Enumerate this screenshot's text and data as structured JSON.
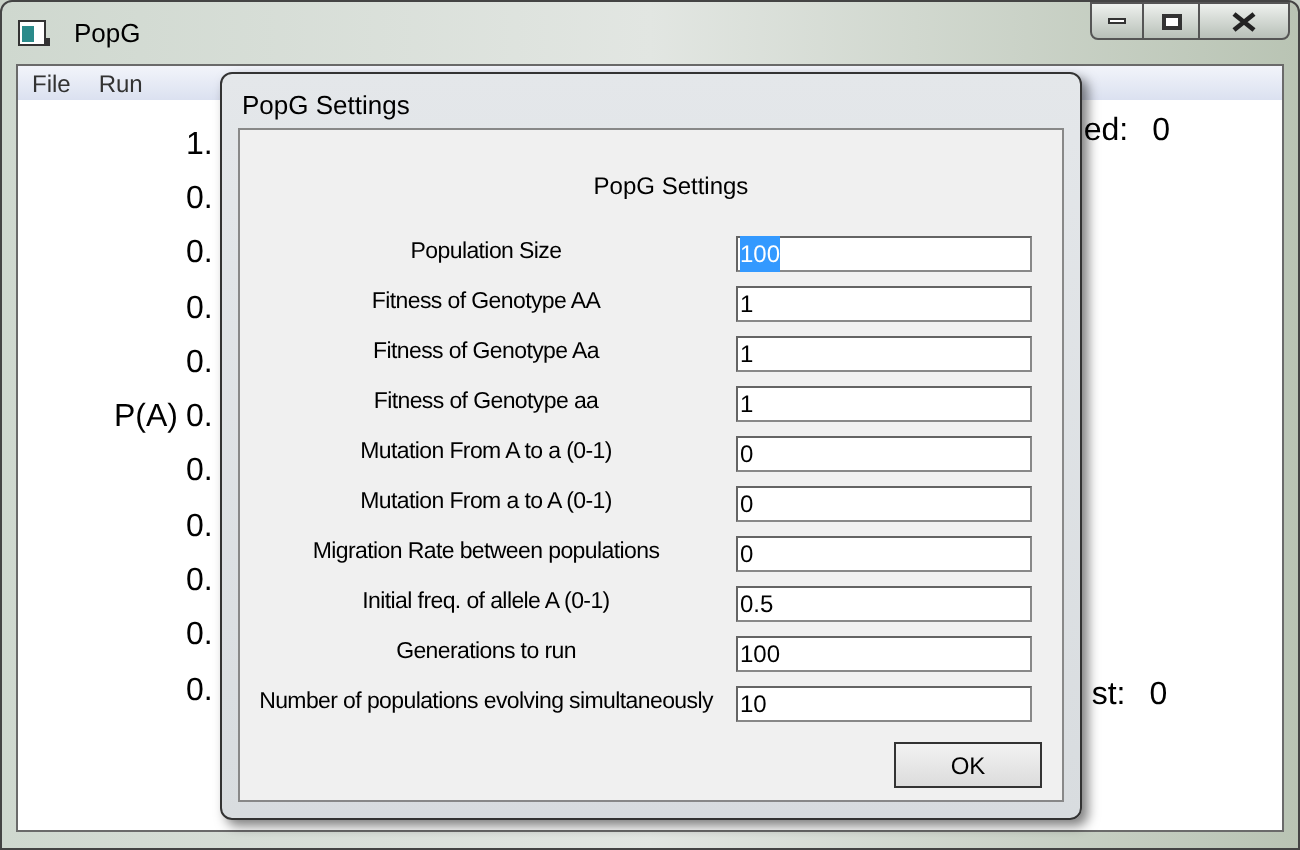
{
  "window": {
    "title": "PopG"
  },
  "menu": [
    "File",
    "Run"
  ],
  "plot": {
    "y_ticks": [
      {
        "label": "1."
      },
      {
        "label": "0."
      },
      {
        "label": "0."
      },
      {
        "label": "0."
      },
      {
        "label": "0."
      },
      {
        "label": "0.",
        "axis_title": "P(A)"
      },
      {
        "label": "0."
      },
      {
        "label": "0."
      },
      {
        "label": "0."
      },
      {
        "label": "0."
      },
      {
        "label": "0."
      }
    ],
    "stat_top": {
      "label": "ed:",
      "value": "0"
    },
    "stat_bottom": {
      "label": "st:",
      "value": "0"
    }
  },
  "dialog": {
    "title": "PopG Settings",
    "heading": "PopG Settings",
    "fields": [
      {
        "label": "Population Size",
        "value": "100",
        "text_selected": true
      },
      {
        "label": "Fitness of Genotype AA",
        "value": "1",
        "text_selected": false
      },
      {
        "label": "Fitness of Genotype Aa",
        "value": "1",
        "text_selected": false
      },
      {
        "label": "Fitness of Genotype aa",
        "value": "1",
        "text_selected": false
      },
      {
        "label": "Mutation From A to a (0-1)",
        "value": "0",
        "text_selected": false
      },
      {
        "label": "Mutation From a to A (0-1)",
        "value": "0",
        "text_selected": false
      },
      {
        "label": "Migration Rate between populations",
        "value": "0",
        "text_selected": false
      },
      {
        "label": "Initial freq. of allele A (0-1)",
        "value": "0.5",
        "text_selected": false
      },
      {
        "label": "Generations to run",
        "value": "100",
        "text_selected": false
      },
      {
        "label": "Number of populations evolving simultaneously",
        "value": "10",
        "text_selected": false
      }
    ],
    "button": "OK"
  }
}
